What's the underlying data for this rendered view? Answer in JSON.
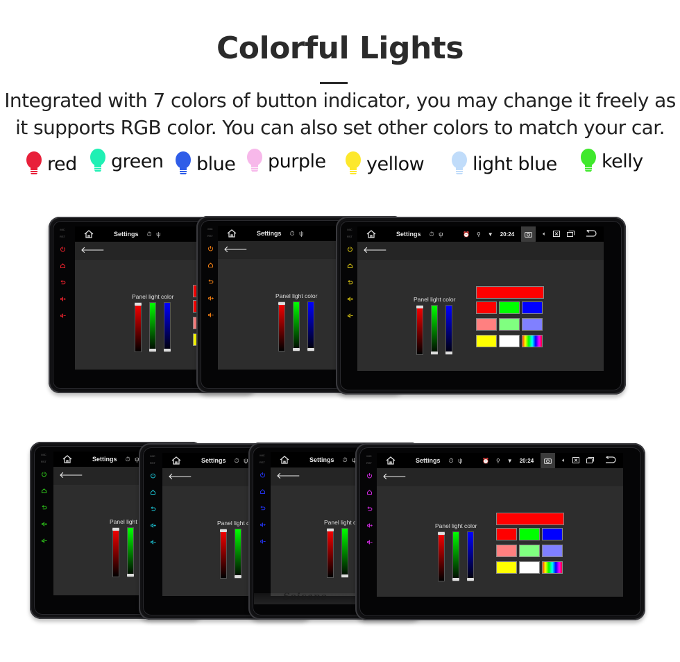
{
  "header": {
    "title": "Colorful Lights",
    "description_line1": "Integrated with 7 colors of button indicator, you may change it freely as",
    "description_line2": "it supports RGB color. You can also set other colors to match your car."
  },
  "legend": [
    {
      "label": "red",
      "color": "#e8203a"
    },
    {
      "label": "green",
      "color": "#1ff0b4"
    },
    {
      "label": "blue",
      "color": "#2f5de8"
    },
    {
      "label": "purple",
      "color": "#f7b8ea"
    },
    {
      "label": "yellow",
      "color": "#fde82c"
    },
    {
      "label": "light blue",
      "color": "#c0dcfa"
    },
    {
      "label": "kelly",
      "color": "#3fe82c"
    }
  ],
  "screen": {
    "app_title": "Settings",
    "side_tags": [
      "MIC",
      "RST"
    ],
    "status_time": "20:24",
    "panel_label": "Panel light color",
    "back_icon": "arrow-left-icon",
    "home_icon": "home-icon",
    "status_icons": [
      "timer-icon",
      "usb-icon"
    ],
    "right_icons": [
      "alarm-icon",
      "location-icon",
      "wifi-icon",
      "camera-icon",
      "volume-icon",
      "close-box-icon",
      "recent-apps-icon",
      "return-icon"
    ],
    "side_icons": [
      "power-icon",
      "home-icon",
      "back-icon",
      "volume-up-icon",
      "volume-down-icon"
    ],
    "sliders": [
      {
        "name": "red",
        "color": "#ff0000",
        "value_fraction": 1.0
      },
      {
        "name": "green",
        "color": "#00ff00",
        "value_fraction": 0.0
      },
      {
        "name": "blue",
        "color": "#0000ff",
        "value_fraction": 0.0
      }
    ],
    "preview_color": "#ff0000",
    "swatches": [
      "#ff0000",
      "#00ff00",
      "#0000ff",
      "#ff8080",
      "#80ff80",
      "#8080ff",
      "#ffff00",
      "#ffffff",
      "rainbow"
    ]
  },
  "devices": [
    {
      "id": "d1",
      "indicator_color": "#e0202a",
      "row": "top"
    },
    {
      "id": "d2",
      "indicator_color": "#e87a12",
      "row": "top"
    },
    {
      "id": "d3",
      "indicator_color": "#d8c412",
      "row": "top"
    },
    {
      "id": "d4",
      "indicator_color": "#2ec41a",
      "row": "bottom"
    },
    {
      "id": "d5",
      "indicator_color": "#1ab8c8",
      "row": "bottom"
    },
    {
      "id": "d6",
      "indicator_color": "#2030e0",
      "row": "bottom"
    },
    {
      "id": "d7",
      "indicator_color": "#c828d8",
      "row": "bottom"
    }
  ],
  "watermark": "Seicane"
}
